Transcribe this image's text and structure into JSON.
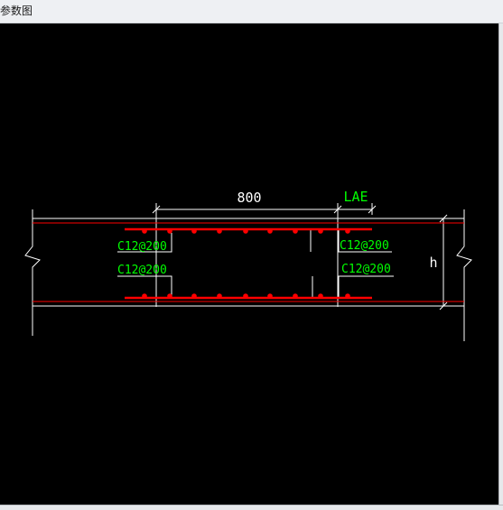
{
  "window": {
    "title": "参数图"
  },
  "drawing": {
    "dimension_span": "800",
    "anchorage_label": "LAE",
    "height_label": "h",
    "top_left_rebar": "C12@200",
    "top_right_rebar": "C12@200",
    "bottom_left_rebar": "C12@200",
    "bottom_right_rebar": "C12@200"
  },
  "colors": {
    "background": "#000000",
    "outline": "#ffffff",
    "rebar": "#ff0000",
    "label": "#00ff00"
  }
}
